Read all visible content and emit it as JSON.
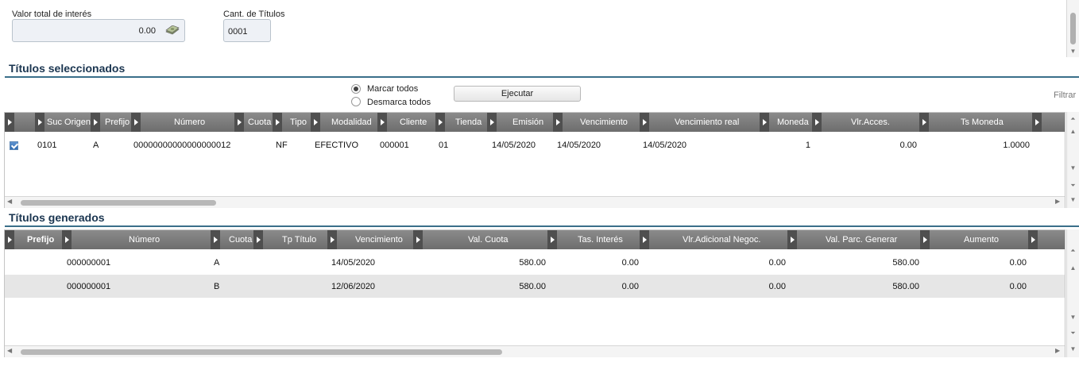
{
  "summary": {
    "interest_label": "Valor total de interés",
    "interest_value": "0.00",
    "count_label": "Cant. de Títulos",
    "count_value": "0001"
  },
  "selected_section": {
    "title": "Títulos seleccionados",
    "radio_mark_all": "Marcar todos",
    "radio_unmark_all": "Desmarca todos",
    "execute_button": "Ejecutar",
    "filter_link": "Filtrar",
    "columns": [
      "Suc Origen",
      "Prefijo",
      "Número",
      "Cuota",
      "Tipo",
      "Modalidad",
      "Cliente",
      "Tienda",
      "Emisión",
      "Vencimiento",
      "Vencimiento real",
      "Moneda",
      "Vlr.Acces.",
      "Ts Moneda"
    ],
    "rows": [
      {
        "checked": true,
        "cells": [
          "0101",
          "A",
          "00000000000000000012",
          "",
          "NF",
          "EFECTIVO",
          "000001",
          "01",
          "14/05/2020",
          "14/05/2020",
          "14/05/2020",
          "1",
          "0.00",
          "1.0000"
        ]
      }
    ]
  },
  "generated_section": {
    "title": "Títulos generados",
    "columns": [
      "Prefijo",
      "Número",
      "Cuota",
      "Tp Título",
      "Vencimiento",
      "Val. Cuota",
      "Tas. Interés",
      "Vlr.Adicional Negoc.",
      "Val. Parc. Generar",
      "Aumento"
    ],
    "rows": [
      [
        "",
        "000000001",
        "A",
        "",
        "14/05/2020",
        "580.00",
        "0.00",
        "0.00",
        "580.00",
        "0.00"
      ],
      [
        "",
        "000000001",
        "B",
        "",
        "12/06/2020",
        "580.00",
        "0.00",
        "0.00",
        "580.00",
        "0.00"
      ]
    ]
  },
  "icons": {
    "money": "money-stack-icon",
    "scroll_up": "scroll-up-icon",
    "scroll_down": "scroll-down-icon",
    "scroll_left": "scroll-left-icon",
    "scroll_right": "scroll-right-icon"
  },
  "colors": {
    "section_title": "#1a3550",
    "section_rule": "#3a6f8a",
    "header_bg": "#7a7a7a",
    "row_alt": "#e6e6e6",
    "checkbox": "#2f6bb0"
  }
}
